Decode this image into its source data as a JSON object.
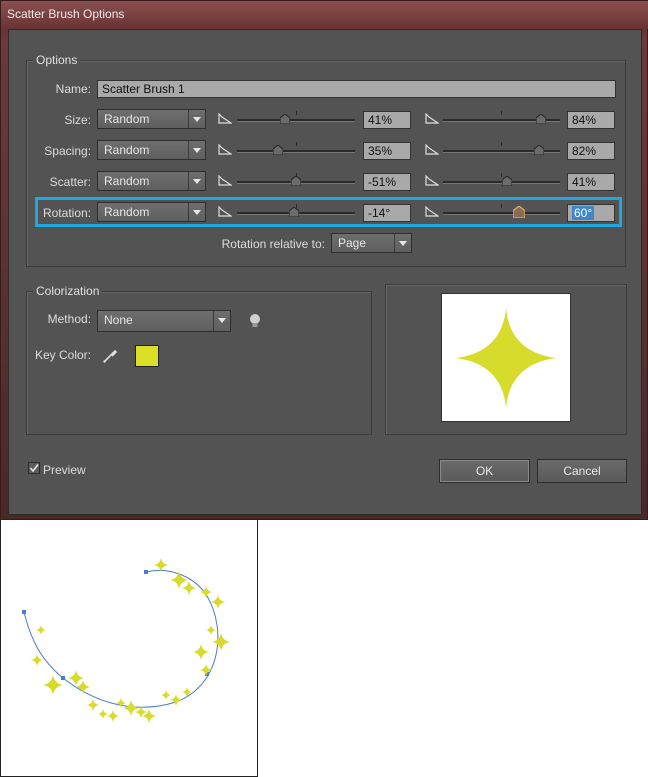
{
  "window": {
    "title": "Scatter Brush Options"
  },
  "options": {
    "group_title": "Options",
    "name_label": "Name:",
    "name_value": "Scatter Brush 1",
    "rows": [
      {
        "label": "Size:",
        "mode": "Random",
        "min_value": "41%",
        "max_value": "84%",
        "min_level": 0.41,
        "max_level": 0.84
      },
      {
        "label": "Spacing:",
        "mode": "Random",
        "min_value": "35%",
        "max_value": "82%",
        "min_level": 0.35,
        "max_level": 0.82
      },
      {
        "label": "Scatter:",
        "mode": "Random",
        "min_value": "-51%",
        "max_value": "41%",
        "min_level": 0.5,
        "max_level": 0.55
      },
      {
        "label": "Rotation:",
        "mode": "Random",
        "min_value": "-14°",
        "max_value": "60°",
        "min_level": 0.48,
        "max_level": 0.65
      }
    ],
    "rotation_relative_label": "Rotation relative to:",
    "rotation_relative_value": "Page"
  },
  "colorization": {
    "group_title": "Colorization",
    "method_label": "Method:",
    "method_value": "None",
    "key_color_label": "Key Color:",
    "key_color": "#dbdf27"
  },
  "preview": {
    "label": "Preview",
    "checked": true
  },
  "buttons": {
    "ok": "OK",
    "cancel": "Cancel"
  },
  "colors": {
    "star": "#d7db2b",
    "path": "#4a7bd0",
    "highlight": "#1ea7dc"
  }
}
